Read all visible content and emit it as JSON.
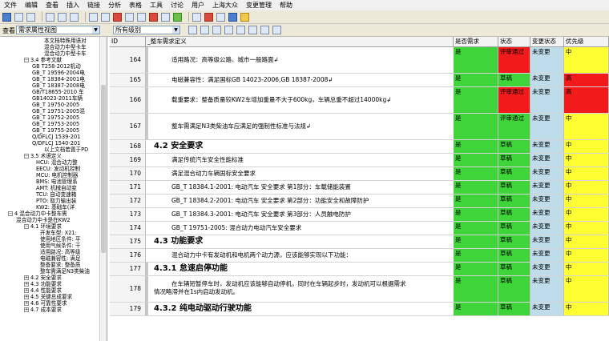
{
  "menu": [
    "文件",
    "编辑",
    "查看",
    "插入",
    "链接",
    "分析",
    "表格",
    "工具",
    "讨论",
    "用户",
    "上海大众",
    "变更管理",
    "帮助"
  ],
  "view": {
    "label": "查看",
    "view_select": "需求属性视图",
    "level_select": "所有级别"
  },
  "columns": {
    "id": "ID",
    "req": "_整车需求定义",
    "flag": "是否需求",
    "status": "状态",
    "change": "变更状态",
    "priority": "优先级"
  },
  "tree": [
    "本文档特殊用语对",
    "混合动力中型卡车",
    "混合动力中型卡车",
    "3.4 参考文献",
    "GB T258-2012机动",
    "GB_T 19596-2004电",
    "GB_T 18384-2001电",
    "GB_T 18387-2008电",
    "GB/T18655-2010 车",
    "GB14023-2011车辆",
    "GB_T 19750-2005",
    "GB_T 19751-2005混",
    "GB_T 19752-2005",
    "GB_T 19753-2005",
    "GB_T 19755-2005",
    "Q/DFLCJ 1539-201",
    "Q/DFLCJ 1540-201",
    "以上文档若置于PD",
    "3.5 术语定义",
    "HCU: 混合动力整",
    "EECU: 发动机控制",
    "MCU: 电机控制器",
    "BMS: 电池管理系",
    "AMT: 机械自动变",
    "TCU: 自动变速箱",
    "PTO: 取力输出装",
    "KW2: 基础车(详",
    "4 混合动力中卡整车需",
    "混合动力中卡是在KW2",
    "4.1 环境要求",
    "开发车型: X21:",
    "使用地区条件: 平",
    "使用气候条件: 干",
    "适用路况: 高等级",
    "电磁兼容性: 满足",
    "整备要求: 整备质",
    "整车需满足N3类柴油",
    "4.2 安全要求",
    "4.3 功能要求",
    "4.4 性能要求",
    "4.5 关键总成要求",
    "4.6 可靠性要求",
    "4.7 成本要求"
  ],
  "rows": [
    {
      "id": "164",
      "text": "适用路况：高等级公路、城市一般路面↲",
      "flag": "是",
      "status": "评审通过",
      "change": "未变更",
      "priority": "中",
      "sc": "r",
      "pc": "y",
      "h": false,
      "bar": true
    },
    {
      "id": "165",
      "text": "电磁兼容性：满足国标GB 14023-2006,GB 18387-2008↲",
      "flag": "是",
      "status": "草稿",
      "change": "未变更",
      "priority": "高",
      "sc": "g",
      "pc": "r",
      "h": false,
      "bar": true
    },
    {
      "id": "166",
      "text": "载重要求：整备质量较KW2车增加重量不大于600kg，车辆总重不超过14000kg↲",
      "flag": "是",
      "status": "评审通过",
      "change": "未变更",
      "priority": "高",
      "sc": "r",
      "pc": "r",
      "h": false,
      "bar": true
    },
    {
      "id": "167",
      "text": "整车需满足N3类柴油车应满足的强制性标准与法规↲",
      "flag": "是",
      "status": "评审通过",
      "change": "未变更",
      "priority": "中",
      "sc": "g",
      "pc": "y",
      "h": false,
      "bar": true
    },
    {
      "id": "168",
      "text": "4.2 安全要求",
      "flag": "是",
      "status": "草稿",
      "change": "未变更",
      "priority": "中",
      "sc": "g",
      "pc": "y",
      "h": true,
      "bar": false
    },
    {
      "id": "169",
      "text": "满足传统汽车安全性能标准",
      "flag": "是",
      "status": "草稿",
      "change": "未变更",
      "priority": "中",
      "sc": "g",
      "pc": "y",
      "h": false,
      "bar": false
    },
    {
      "id": "170",
      "text": "满足混合动力车辆国标安全要求",
      "flag": "是",
      "status": "草稿",
      "change": "未变更",
      "priority": "中",
      "sc": "g",
      "pc": "y",
      "h": false,
      "bar": false
    },
    {
      "id": "171",
      "text": "GB_T 18384.1-2001: 电动汽车 安全要求 第1部分：车载储能装置",
      "flag": "是",
      "status": "草稿",
      "change": "未变更",
      "priority": "中",
      "sc": "g",
      "pc": "y",
      "h": false,
      "bar": false
    },
    {
      "id": "172",
      "text": "GB_T 18384.2-2001: 电动汽车 安全要求 第2部分：功能安全和故障防护",
      "flag": "是",
      "status": "草稿",
      "change": "未变更",
      "priority": "中",
      "sc": "g",
      "pc": "y",
      "h": false,
      "bar": false
    },
    {
      "id": "173",
      "text": "GB_T 18384.3-2001: 电动汽车 安全要求 第3部分：人员触电防护",
      "flag": "是",
      "status": "草稿",
      "change": "未变更",
      "priority": "中",
      "sc": "g",
      "pc": "y",
      "h": false,
      "bar": false
    },
    {
      "id": "174",
      "text": "GB_T 19751-2005:   混合动力电动汽车安全要求",
      "flag": "是",
      "status": "草稿",
      "change": "未变更",
      "priority": "中",
      "sc": "g",
      "pc": "y",
      "h": false,
      "bar": false
    },
    {
      "id": "175",
      "text": "4.3 功能要求",
      "flag": "是",
      "status": "草稿",
      "change": "未变更",
      "priority": "中",
      "sc": "g",
      "pc": "y",
      "h": true,
      "bar": false
    },
    {
      "id": "176",
      "text": "混合动力中卡有发动机和电机两个动力源，应该能够实现以下功能：",
      "flag": "是",
      "status": "草稿",
      "change": "未变更",
      "priority": "中",
      "sc": "g",
      "pc": "y",
      "h": false,
      "bar": false
    },
    {
      "id": "177",
      "text": "4.3.1 怠速启停功能",
      "flag": "是",
      "status": "草稿",
      "change": "未变更",
      "priority": "中",
      "sc": "g",
      "pc": "y",
      "h": true,
      "bar": true
    },
    {
      "id": "178",
      "text": "在车辆短暂停车时，发动机应该能够自动停机，同时在车辆起步时，发动机可以根据需求",
      "text2": "情况略滞并在1s内启动发动机。",
      "flag": "是",
      "status": "草稿",
      "change": "未变更",
      "priority": "中",
      "sc": "g",
      "pc": "y",
      "h": false,
      "bar": true
    },
    {
      "id": "179",
      "text": "4.3.2 纯电动驱动行驶功能",
      "flag": "是",
      "status": "草稿",
      "change": "未变更",
      "priority": "中",
      "sc": "g",
      "pc": "y",
      "h": true,
      "bar": true
    }
  ]
}
